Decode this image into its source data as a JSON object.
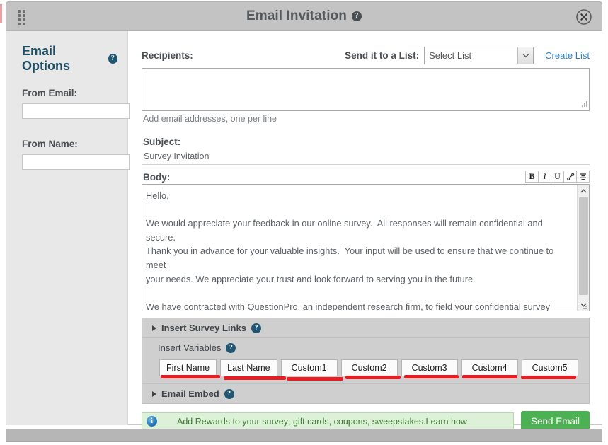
{
  "window": {
    "title": "Email Invitation",
    "help_icon": "help-circle-icon",
    "drag_handle_icon": "drag-handle-icon",
    "close_icon": "close-circle-icon"
  },
  "sidebar": {
    "heading": "Email Options",
    "help_icon": "help-circle-icon",
    "fields": [
      {
        "label": "From Email:",
        "value": "",
        "placeholder": ""
      },
      {
        "label": "From Name:",
        "value": "",
        "placeholder": ""
      }
    ]
  },
  "main": {
    "recipients_label": "Recipients:",
    "send_to_list_label": "Send it to a List:",
    "list_select_value": "Select List",
    "list_select_options": [
      "Select List"
    ],
    "create_list_link": "Create List",
    "recipients_value": "",
    "recipients_hint": "Add email addresses, one per line",
    "subject_label": "Subject:",
    "subject_value": "Survey Invitation",
    "body_label": "Body:",
    "toolbar": [
      {
        "name": "bold-icon",
        "glyph": "B"
      },
      {
        "name": "italic-icon",
        "glyph": "I"
      },
      {
        "name": "underline-icon",
        "glyph": "U"
      },
      {
        "name": "link-icon",
        "glyph": "✂"
      },
      {
        "name": "align-icon",
        "glyph": "≡"
      }
    ],
    "body_part1": "Hello,\n\nWe would appreciate your feedback in our online survey.  All responses will remain confidential and secure.\nThank you in advance for your valuable insights.  Your input will be used to ensure that we continue to meet\nyour needs. We appreciate your trust and look forward to serving you in the future.\n\nWe have contracted with ",
    "body_spellcheck_word": "QuestionPro",
    "body_part2": ", an independent research firm, to field your confidential survey\nresponses.  Please click on this link to complete the survey:\n\n<SURVEY_LINK>",
    "scrollbar_up": "▲",
    "scrollbar_down": "▼"
  },
  "sections": {
    "insert_survey_links": {
      "label": "Insert Survey Links",
      "help_icon": "help-circle-icon",
      "expanded": false
    },
    "insert_variables": {
      "label": "Insert Variables",
      "help_icon": "help-circle-icon",
      "expanded": true,
      "buttons": [
        "First Name",
        "Last Name",
        "Custom1",
        "Custom2",
        "Custom3",
        "Custom4",
        "Custom5"
      ],
      "highlight_color": "#e81c23"
    },
    "email_embed": {
      "label": "Email Embed",
      "help_icon": "help-circle-icon",
      "expanded": false
    }
  },
  "footer": {
    "info_icon": "info-circle-icon",
    "reward_text": "Add Rewards to your survey; gift cards, coupons, sweepstakes.Learn how",
    "send_button": "Send Email",
    "send_button_color": "#4cb152"
  }
}
